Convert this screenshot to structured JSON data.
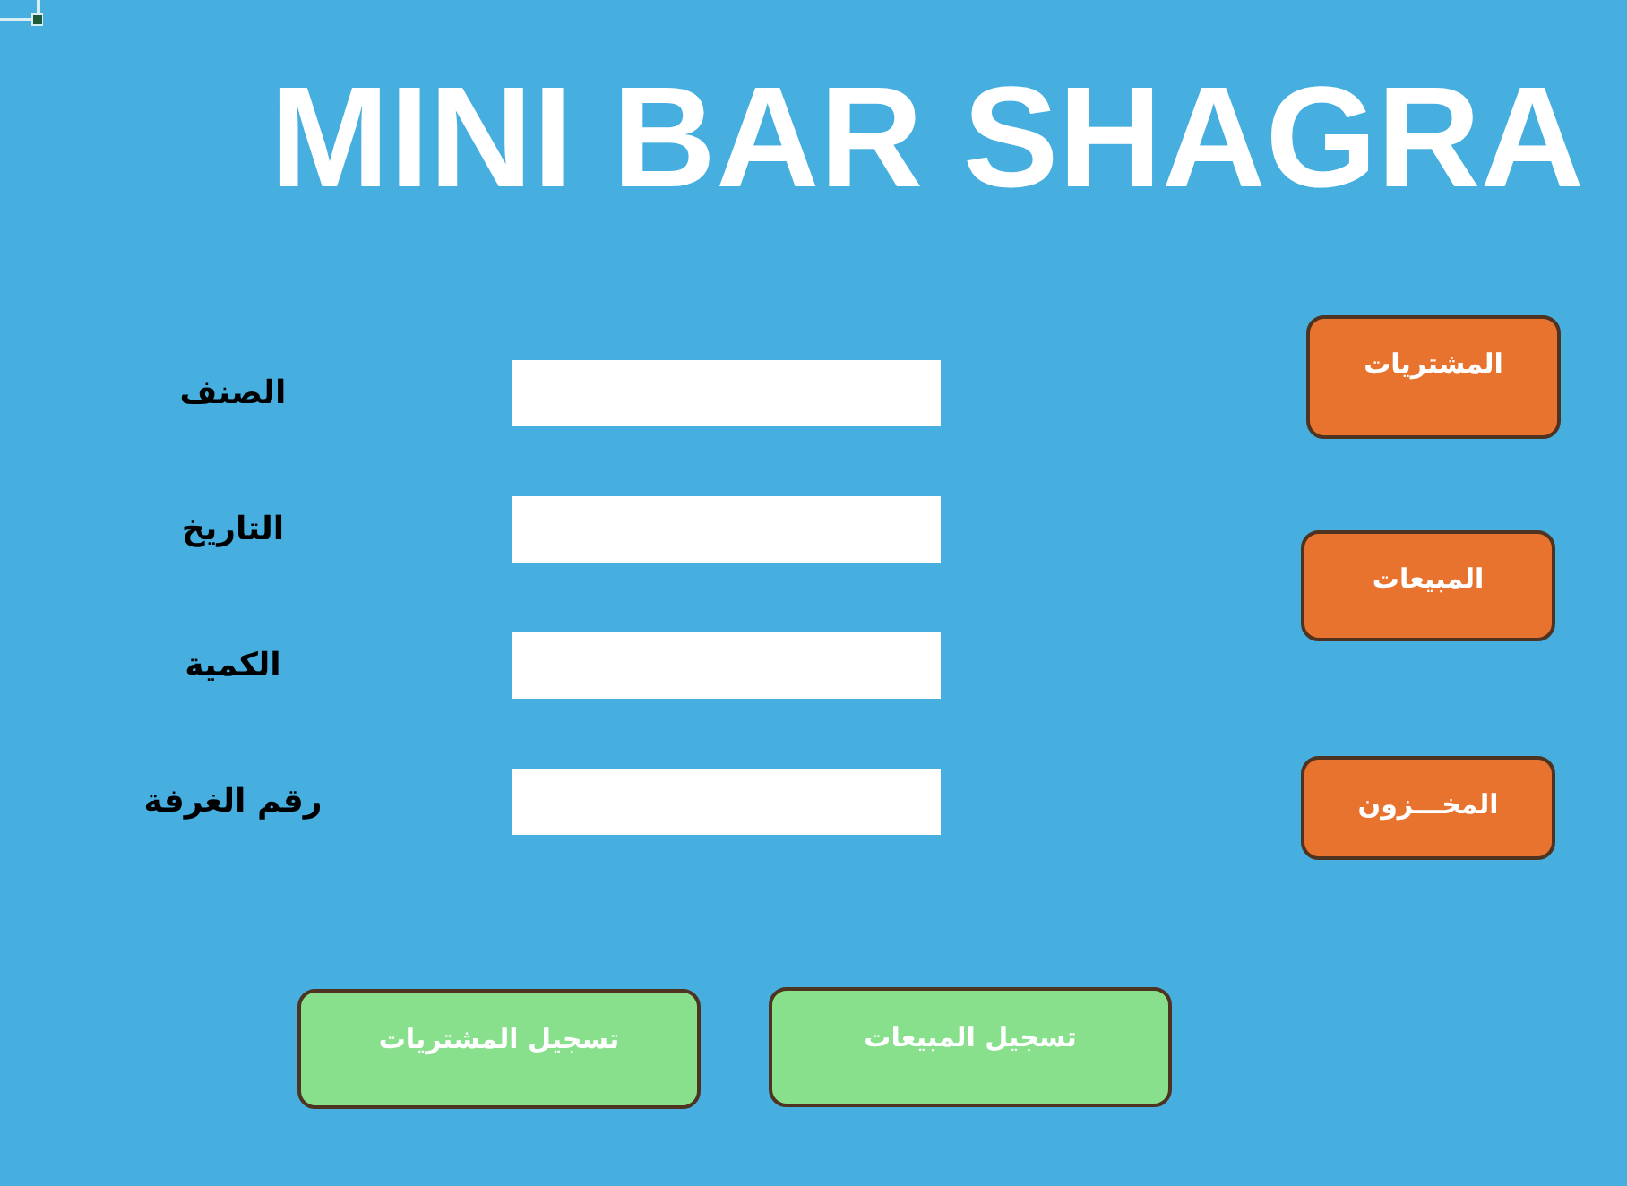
{
  "title": "MINI BAR SHAGRA",
  "form": {
    "fields": [
      {
        "label": "الصنف"
      },
      {
        "label": "التاريخ"
      },
      {
        "label": "الكمية"
      },
      {
        "label": "رقم الغرفة"
      }
    ]
  },
  "side_buttons": [
    "المشتريات",
    "المبيعات",
    "المخـــزون"
  ],
  "bottom_buttons": [
    "تسجيل المبيعات",
    "تسجيل المشتريات"
  ]
}
